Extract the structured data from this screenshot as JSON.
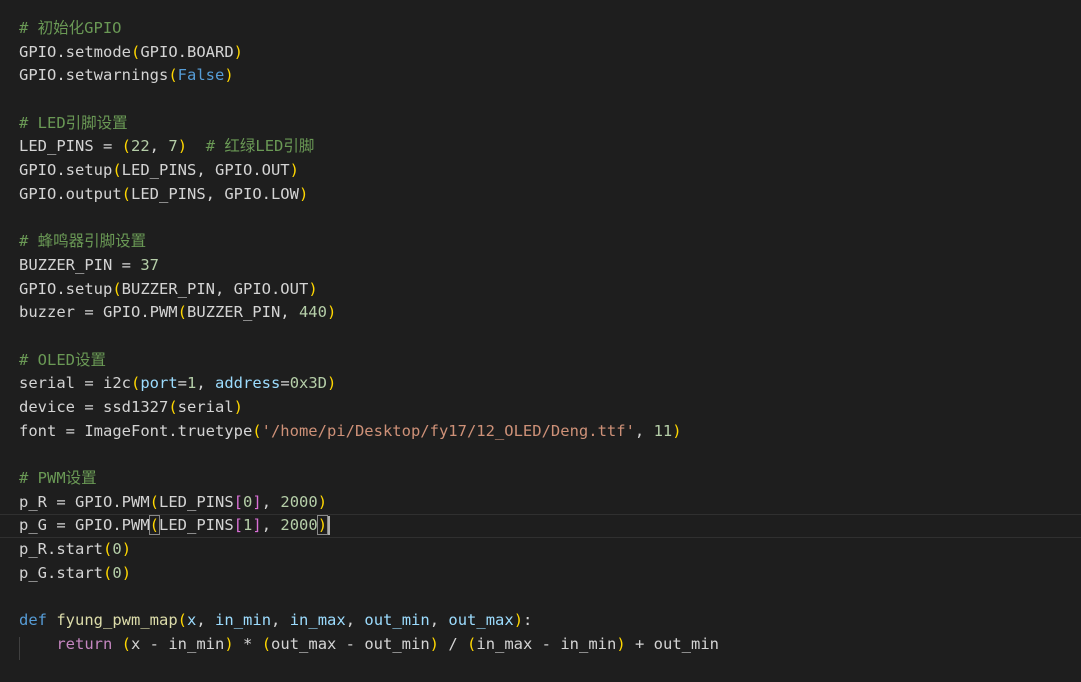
{
  "editor": {
    "lines": [
      [
        {
          "t": "# 初始化GPIO",
          "c": "cm"
        }
      ],
      [
        {
          "t": "GPIO.setmode"
        },
        {
          "t": "(",
          "c": "p1"
        },
        {
          "t": "GPIO.BOARD"
        },
        {
          "t": ")",
          "c": "p1"
        }
      ],
      [
        {
          "t": "GPIO.setwarnings"
        },
        {
          "t": "(",
          "c": "p1"
        },
        {
          "t": "False",
          "c": "kw"
        },
        {
          "t": ")",
          "c": "p1"
        }
      ],
      [],
      [
        {
          "t": "# LED引脚设置",
          "c": "cm"
        }
      ],
      [
        {
          "t": "LED_PINS = "
        },
        {
          "t": "(",
          "c": "p1"
        },
        {
          "t": "22",
          "c": "num"
        },
        {
          "t": ", "
        },
        {
          "t": "7",
          "c": "num"
        },
        {
          "t": ")",
          "c": "p1"
        },
        {
          "t": "  "
        },
        {
          "t": "# 红绿LED引脚",
          "c": "cm"
        }
      ],
      [
        {
          "t": "GPIO.setup"
        },
        {
          "t": "(",
          "c": "p1"
        },
        {
          "t": "LED_PINS, GPIO.OUT"
        },
        {
          "t": ")",
          "c": "p1"
        }
      ],
      [
        {
          "t": "GPIO.output"
        },
        {
          "t": "(",
          "c": "p1"
        },
        {
          "t": "LED_PINS, GPIO.LOW"
        },
        {
          "t": ")",
          "c": "p1"
        }
      ],
      [],
      [
        {
          "t": "# 蜂鸣器引脚设置",
          "c": "cm"
        }
      ],
      [
        {
          "t": "BUZZER_PIN = "
        },
        {
          "t": "37",
          "c": "num"
        }
      ],
      [
        {
          "t": "GPIO.setup"
        },
        {
          "t": "(",
          "c": "p1"
        },
        {
          "t": "BUZZER_PIN, GPIO.OUT"
        },
        {
          "t": ")",
          "c": "p1"
        }
      ],
      [
        {
          "t": "buzzer = GPIO.PWM"
        },
        {
          "t": "(",
          "c": "p1"
        },
        {
          "t": "BUZZER_PIN, "
        },
        {
          "t": "440",
          "c": "num"
        },
        {
          "t": ")",
          "c": "p1"
        }
      ],
      [],
      [
        {
          "t": "# OLED设置",
          "c": "cm"
        }
      ],
      [
        {
          "t": "serial = i2c"
        },
        {
          "t": "(",
          "c": "p1"
        },
        {
          "t": "port",
          "c": "prm"
        },
        {
          "t": "="
        },
        {
          "t": "1",
          "c": "num"
        },
        {
          "t": ", "
        },
        {
          "t": "address",
          "c": "prm"
        },
        {
          "t": "="
        },
        {
          "t": "0x3D",
          "c": "num"
        },
        {
          "t": ")",
          "c": "p1"
        }
      ],
      [
        {
          "t": "device = ssd1327"
        },
        {
          "t": "(",
          "c": "p1"
        },
        {
          "t": "serial"
        },
        {
          "t": ")",
          "c": "p1"
        }
      ],
      [
        {
          "t": "font = ImageFont.truetype"
        },
        {
          "t": "(",
          "c": "p1"
        },
        {
          "t": "'/home/pi/Desktop/fy17/12_OLED/Deng.ttf'",
          "c": "str"
        },
        {
          "t": ", "
        },
        {
          "t": "11",
          "c": "num"
        },
        {
          "t": ")",
          "c": "p1"
        }
      ],
      [],
      [
        {
          "t": "# PWM设置",
          "c": "cm"
        }
      ],
      [
        {
          "t": "p_R = GPIO.PWM"
        },
        {
          "t": "(",
          "c": "p1"
        },
        {
          "t": "LED_PINS"
        },
        {
          "t": "[",
          "c": "p2"
        },
        {
          "t": "0",
          "c": "num"
        },
        {
          "t": "]",
          "c": "p2"
        },
        {
          "t": ", "
        },
        {
          "t": "2000",
          "c": "num"
        },
        {
          "t": ")",
          "c": "p1"
        }
      ],
      [
        {
          "t": "p_G = GPIO.PWM"
        },
        {
          "t": "(",
          "c": "p1 bmatch"
        },
        {
          "t": "LED_PINS"
        },
        {
          "t": "[",
          "c": "p2"
        },
        {
          "t": "1",
          "c": "num"
        },
        {
          "t": "]",
          "c": "p2"
        },
        {
          "t": ", "
        },
        {
          "t": "2000",
          "c": "num"
        },
        {
          "t": ")",
          "c": "p1 bmatch"
        },
        {
          "cursor": true
        }
      ],
      [
        {
          "t": "p_R.start"
        },
        {
          "t": "(",
          "c": "p1"
        },
        {
          "t": "0",
          "c": "num"
        },
        {
          "t": ")",
          "c": "p1"
        }
      ],
      [
        {
          "t": "p_G.start"
        },
        {
          "t": "(",
          "c": "p1"
        },
        {
          "t": "0",
          "c": "num"
        },
        {
          "t": ")",
          "c": "p1"
        }
      ],
      [],
      [
        {
          "t": "def",
          "c": "kw"
        },
        {
          "t": " "
        },
        {
          "t": "fyung_pwm_map",
          "c": "fn"
        },
        {
          "t": "(",
          "c": "p1"
        },
        {
          "t": "x",
          "c": "prm"
        },
        {
          "t": ", "
        },
        {
          "t": "in_min",
          "c": "prm"
        },
        {
          "t": ", "
        },
        {
          "t": "in_max",
          "c": "prm"
        },
        {
          "t": ", "
        },
        {
          "t": "out_min",
          "c": "prm"
        },
        {
          "t": ", "
        },
        {
          "t": "out_max",
          "c": "prm"
        },
        {
          "t": ")",
          "c": "p1"
        },
        {
          "t": ":"
        }
      ],
      [
        {
          "t": "    "
        },
        {
          "t": "return",
          "c": "ctl"
        },
        {
          "t": " "
        },
        {
          "t": "(",
          "c": "p1"
        },
        {
          "t": "x - in_min"
        },
        {
          "t": ")",
          "c": "p1"
        },
        {
          "t": " * "
        },
        {
          "t": "(",
          "c": "p1"
        },
        {
          "t": "out_max - out_min"
        },
        {
          "t": ")",
          "c": "p1"
        },
        {
          "t": " / "
        },
        {
          "t": "(",
          "c": "p1"
        },
        {
          "t": "in_max - in_min"
        },
        {
          "t": ")",
          "c": "p1"
        },
        {
          "t": " + out_min"
        }
      ]
    ],
    "current_line": 21
  }
}
